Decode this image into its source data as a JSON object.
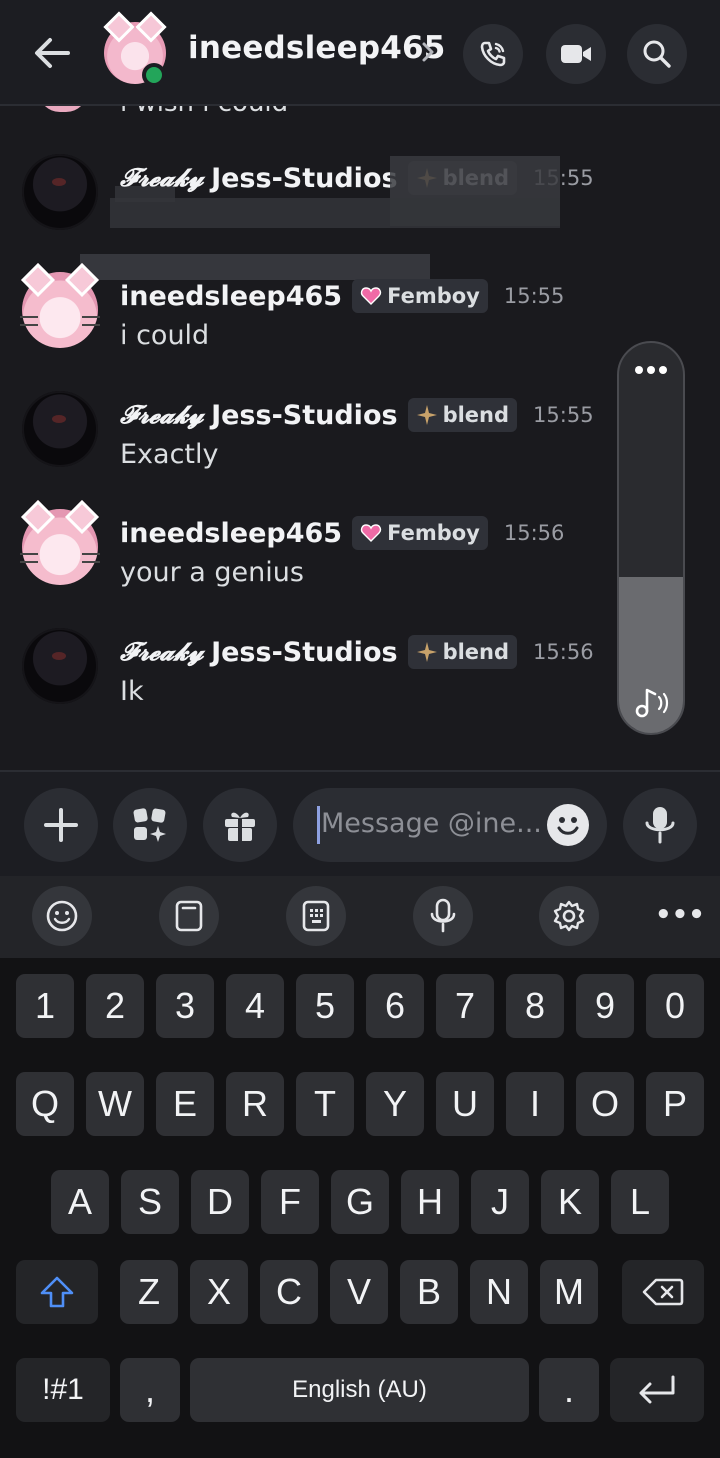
{
  "header": {
    "username": "ineedsleep465",
    "status": "online"
  },
  "messages": {
    "partial_top_text": "i wish i could",
    "items": [
      {
        "prefix": "𝓕𝓻𝓮𝓪𝓴𝔂",
        "author": "Jess-Studios",
        "tag": "blend",
        "time": "15:55",
        "text": ""
      },
      {
        "prefix": "",
        "author": "ineedsleep465",
        "tag": "Femboy",
        "time": "15:55",
        "text": "i could"
      },
      {
        "prefix": "𝓕𝓻𝓮𝓪𝓴𝔂",
        "author": "Jess-Studios",
        "tag": "blend",
        "time": "15:55",
        "text": "Exactly"
      },
      {
        "prefix": "",
        "author": "ineedsleep465",
        "tag": "Femboy",
        "time": "15:56",
        "text": "your a genius"
      },
      {
        "prefix": "𝓕𝓻𝓮𝓪𝓴𝔂",
        "author": "Jess-Studios",
        "tag": "blend",
        "time": "15:56",
        "text": "Ik"
      }
    ]
  },
  "volume": {
    "level": 0.4,
    "more_label": "•••"
  },
  "composer": {
    "placeholder": "Message @ine..."
  },
  "keyboard": {
    "toolbar_more": "•••",
    "row_numbers": [
      "1",
      "2",
      "3",
      "4",
      "5",
      "6",
      "7",
      "8",
      "9",
      "0"
    ],
    "row1": [
      "Q",
      "W",
      "E",
      "R",
      "T",
      "Y",
      "U",
      "I",
      "O",
      "P"
    ],
    "row2": [
      "A",
      "S",
      "D",
      "F",
      "G",
      "H",
      "J",
      "K",
      "L"
    ],
    "row3": [
      "Z",
      "X",
      "C",
      "V",
      "B",
      "N",
      "M"
    ],
    "symbols_label": "!#1",
    "comma": ",",
    "space_label": "English (AU)",
    "period": "."
  },
  "colors": {
    "background": "#1a1a1e",
    "online": "#23a55a",
    "femboy_heart": "#f06aa6",
    "caret": "#8ea1e1"
  }
}
